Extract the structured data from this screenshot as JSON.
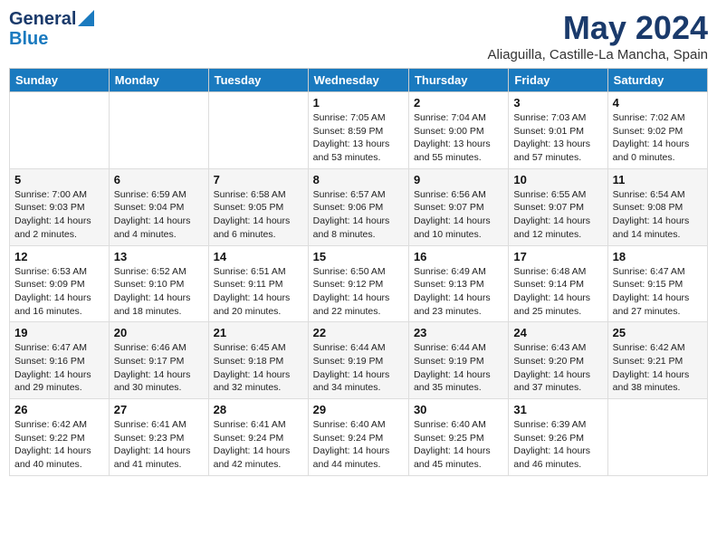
{
  "header": {
    "logo_line1": "General",
    "logo_line2": "Blue",
    "month_title": "May 2024",
    "subtitle": "Aliaguilla, Castille-La Mancha, Spain"
  },
  "days_of_week": [
    "Sunday",
    "Monday",
    "Tuesday",
    "Wednesday",
    "Thursday",
    "Friday",
    "Saturday"
  ],
  "weeks": [
    [
      {
        "day": "",
        "info": ""
      },
      {
        "day": "",
        "info": ""
      },
      {
        "day": "",
        "info": ""
      },
      {
        "day": "1",
        "info": "Sunrise: 7:05 AM\nSunset: 8:59 PM\nDaylight: 13 hours\nand 53 minutes."
      },
      {
        "day": "2",
        "info": "Sunrise: 7:04 AM\nSunset: 9:00 PM\nDaylight: 13 hours\nand 55 minutes."
      },
      {
        "day": "3",
        "info": "Sunrise: 7:03 AM\nSunset: 9:01 PM\nDaylight: 13 hours\nand 57 minutes."
      },
      {
        "day": "4",
        "info": "Sunrise: 7:02 AM\nSunset: 9:02 PM\nDaylight: 14 hours\nand 0 minutes."
      }
    ],
    [
      {
        "day": "5",
        "info": "Sunrise: 7:00 AM\nSunset: 9:03 PM\nDaylight: 14 hours\nand 2 minutes."
      },
      {
        "day": "6",
        "info": "Sunrise: 6:59 AM\nSunset: 9:04 PM\nDaylight: 14 hours\nand 4 minutes."
      },
      {
        "day": "7",
        "info": "Sunrise: 6:58 AM\nSunset: 9:05 PM\nDaylight: 14 hours\nand 6 minutes."
      },
      {
        "day": "8",
        "info": "Sunrise: 6:57 AM\nSunset: 9:06 PM\nDaylight: 14 hours\nand 8 minutes."
      },
      {
        "day": "9",
        "info": "Sunrise: 6:56 AM\nSunset: 9:07 PM\nDaylight: 14 hours\nand 10 minutes."
      },
      {
        "day": "10",
        "info": "Sunrise: 6:55 AM\nSunset: 9:07 PM\nDaylight: 14 hours\nand 12 minutes."
      },
      {
        "day": "11",
        "info": "Sunrise: 6:54 AM\nSunset: 9:08 PM\nDaylight: 14 hours\nand 14 minutes."
      }
    ],
    [
      {
        "day": "12",
        "info": "Sunrise: 6:53 AM\nSunset: 9:09 PM\nDaylight: 14 hours\nand 16 minutes."
      },
      {
        "day": "13",
        "info": "Sunrise: 6:52 AM\nSunset: 9:10 PM\nDaylight: 14 hours\nand 18 minutes."
      },
      {
        "day": "14",
        "info": "Sunrise: 6:51 AM\nSunset: 9:11 PM\nDaylight: 14 hours\nand 20 minutes."
      },
      {
        "day": "15",
        "info": "Sunrise: 6:50 AM\nSunset: 9:12 PM\nDaylight: 14 hours\nand 22 minutes."
      },
      {
        "day": "16",
        "info": "Sunrise: 6:49 AM\nSunset: 9:13 PM\nDaylight: 14 hours\nand 23 minutes."
      },
      {
        "day": "17",
        "info": "Sunrise: 6:48 AM\nSunset: 9:14 PM\nDaylight: 14 hours\nand 25 minutes."
      },
      {
        "day": "18",
        "info": "Sunrise: 6:47 AM\nSunset: 9:15 PM\nDaylight: 14 hours\nand 27 minutes."
      }
    ],
    [
      {
        "day": "19",
        "info": "Sunrise: 6:47 AM\nSunset: 9:16 PM\nDaylight: 14 hours\nand 29 minutes."
      },
      {
        "day": "20",
        "info": "Sunrise: 6:46 AM\nSunset: 9:17 PM\nDaylight: 14 hours\nand 30 minutes."
      },
      {
        "day": "21",
        "info": "Sunrise: 6:45 AM\nSunset: 9:18 PM\nDaylight: 14 hours\nand 32 minutes."
      },
      {
        "day": "22",
        "info": "Sunrise: 6:44 AM\nSunset: 9:19 PM\nDaylight: 14 hours\nand 34 minutes."
      },
      {
        "day": "23",
        "info": "Sunrise: 6:44 AM\nSunset: 9:19 PM\nDaylight: 14 hours\nand 35 minutes."
      },
      {
        "day": "24",
        "info": "Sunrise: 6:43 AM\nSunset: 9:20 PM\nDaylight: 14 hours\nand 37 minutes."
      },
      {
        "day": "25",
        "info": "Sunrise: 6:42 AM\nSunset: 9:21 PM\nDaylight: 14 hours\nand 38 minutes."
      }
    ],
    [
      {
        "day": "26",
        "info": "Sunrise: 6:42 AM\nSunset: 9:22 PM\nDaylight: 14 hours\nand 40 minutes."
      },
      {
        "day": "27",
        "info": "Sunrise: 6:41 AM\nSunset: 9:23 PM\nDaylight: 14 hours\nand 41 minutes."
      },
      {
        "day": "28",
        "info": "Sunrise: 6:41 AM\nSunset: 9:24 PM\nDaylight: 14 hours\nand 42 minutes."
      },
      {
        "day": "29",
        "info": "Sunrise: 6:40 AM\nSunset: 9:24 PM\nDaylight: 14 hours\nand 44 minutes."
      },
      {
        "day": "30",
        "info": "Sunrise: 6:40 AM\nSunset: 9:25 PM\nDaylight: 14 hours\nand 45 minutes."
      },
      {
        "day": "31",
        "info": "Sunrise: 6:39 AM\nSunset: 9:26 PM\nDaylight: 14 hours\nand 46 minutes."
      },
      {
        "day": "",
        "info": ""
      }
    ]
  ]
}
